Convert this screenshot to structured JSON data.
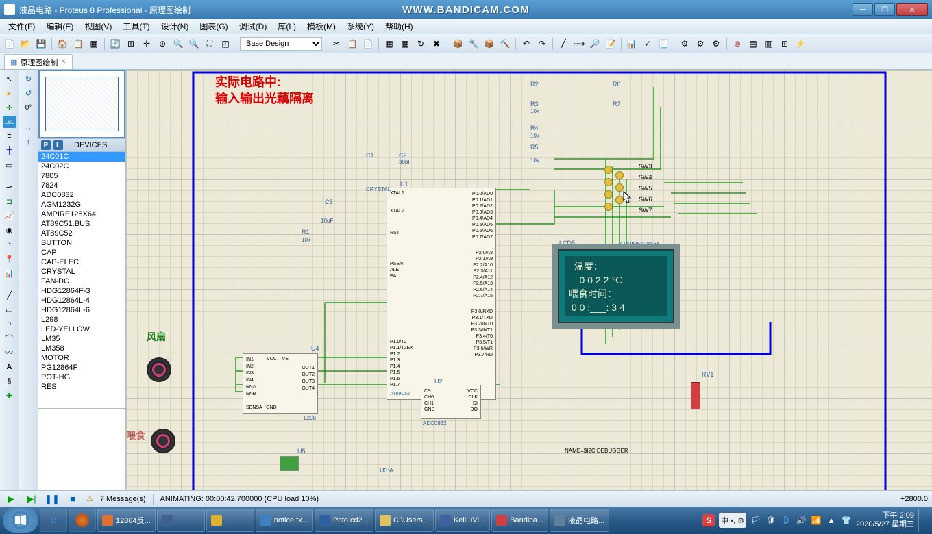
{
  "window": {
    "title": "液晶电路 - Proteus 8 Professional - 原理图绘制",
    "watermark": "WWW.BANDICAM.COM"
  },
  "menu": [
    "文件(F)",
    "编辑(E)",
    "视图(V)",
    "工具(T)",
    "设计(N)",
    "图表(G)",
    "调试(D)",
    "库(L)",
    "模板(M)",
    "系统(Y)",
    "帮助(H)"
  ],
  "tab": {
    "label": "原理图绘制"
  },
  "toolbar": {
    "design_combo": "Base Design"
  },
  "sidebar": {
    "rotation": "0°",
    "devices_label": "DEVICES",
    "p": "P",
    "l": "L",
    "list": [
      "24C01C",
      "24C02C",
      "7805",
      "7824",
      "ADC0832",
      "AGM1232G",
      "AMPIRE128X64",
      "AT89C51.BUS",
      "AT89C52",
      "BUTTON",
      "CAP",
      "CAP-ELEC",
      "CRYSTAL",
      "FAN-DC",
      "HDG12864F-3",
      "HDG12864L-4",
      "HDG12864L-6",
      "L298",
      "LED-YELLOW",
      "LM35",
      "LM358",
      "MOTOR",
      "PG12864F",
      "POT-HG",
      "RES"
    ],
    "selected": "24C01C"
  },
  "canvas": {
    "note_line1": "实际电路中:",
    "note_line2": "输入输出光藕隔离",
    "fan_label": "风扇",
    "feed_label": "喂食",
    "lcd_title": "LCD5",
    "lcd_part": "AMPIRE128X64",
    "lcd_line1": "  温度：",
    "lcd_line2": "    0 0 2 2 ℃",
    "lcd_line3": "喂食时间：",
    "lcd_line4": " 0 0 :___: 3 4",
    "switches": [
      "SW3",
      "SW4",
      "SW5",
      "SW6",
      "SW7"
    ],
    "resistors": [
      "R2",
      "R3",
      "R4",
      "R5",
      "R6",
      "R7"
    ],
    "u1": "U1",
    "u1_part": "AT89C52",
    "u2": "U2",
    "u2_part": "ADC0832",
    "u3": "U3:A",
    "u4": "U4",
    "u4_part": "L298",
    "u5": "U5",
    "c1": "C1",
    "c2": "C2",
    "c2_val": "30pF",
    "c3": "C3",
    "c3_val": "10uF",
    "r1": "R1",
    "r1_val": "10k",
    "rv1": "RV1",
    "crystal": "CRYSTAL",
    "debugger": "NAME=$I2C DEBUGGER",
    "res_val": "10k"
  },
  "status": {
    "messages": "7 Message(s)",
    "animating": "ANIMATING: 00:00:42.700000 (CPU load 10%)",
    "coords": "+2800.0"
  },
  "taskbar": {
    "items": [
      {
        "label": "12864反...",
        "color": "#e07030"
      },
      {
        "label": "",
        "color": "#406090"
      },
      {
        "label": "",
        "color": "#e0b030"
      },
      {
        "label": "notice.tx...",
        "color": "#4080c0"
      },
      {
        "label": "PctoIcd2...",
        "color": "#3060a0"
      },
      {
        "label": "C:\\Users...",
        "color": "#e0c060"
      },
      {
        "label": "Keil uVi...",
        "color": "#4060a0"
      },
      {
        "label": "Bandica...",
        "color": "#d04040"
      },
      {
        "label": "液晶电路...",
        "color": "#6080a0"
      }
    ],
    "ime_s": "S",
    "ime_text": "中 •,  ⚙",
    "time": "下午 2:09",
    "date": "2020/5/27 星期三"
  }
}
